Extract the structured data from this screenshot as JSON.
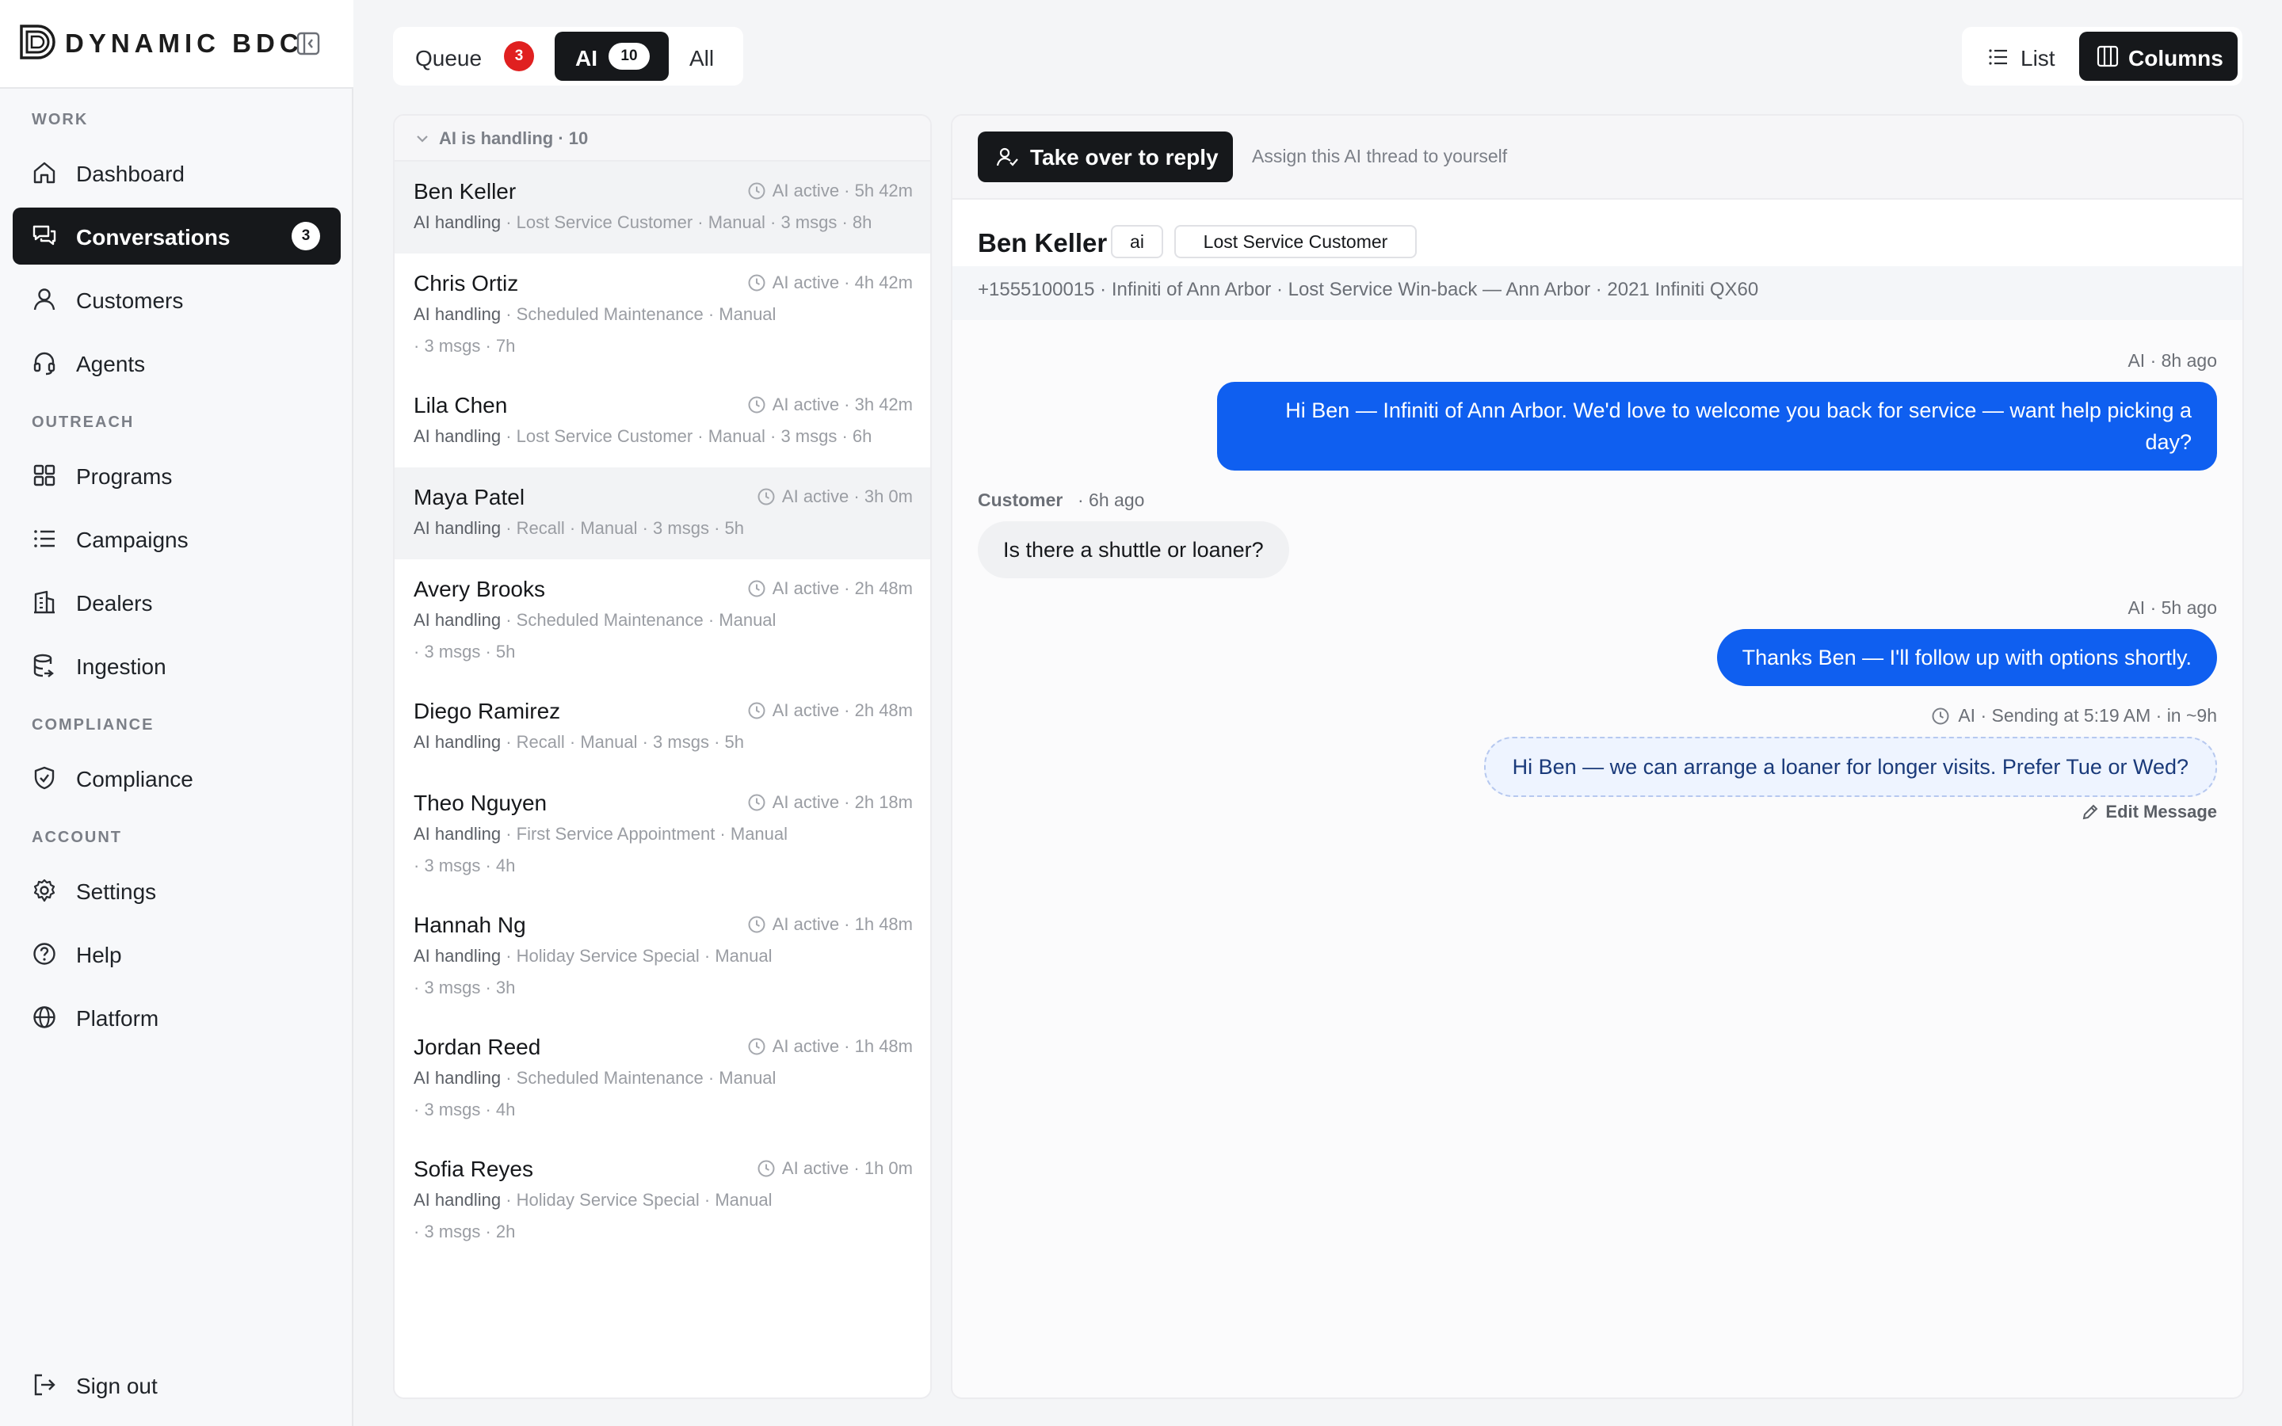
{
  "brand": {
    "name": "DYNAMIC BDC"
  },
  "sidebar": {
    "sections": {
      "work": "WORK",
      "outreach": "OUTREACH",
      "compliance": "COMPLIANCE",
      "account": "ACCOUNT"
    },
    "items": {
      "dashboard": "Dashboard",
      "conversations": "Conversations",
      "conversations_badge": "3",
      "customers": "Customers",
      "agents": "Agents",
      "programs": "Programs",
      "campaigns": "Campaigns",
      "dealers": "Dealers",
      "ingestion": "Ingestion",
      "compliance": "Compliance",
      "settings": "Settings",
      "help": "Help",
      "platform": "Platform",
      "signout": "Sign out"
    }
  },
  "filters": {
    "queue": "Queue",
    "queue_count": "3",
    "ai": "AI",
    "ai_count": "10",
    "all": "All"
  },
  "view": {
    "list": "List",
    "columns": "Columns"
  },
  "list": {
    "group_title": "AI is handling · 10",
    "ai_tag": "AI handling",
    "rows": [
      {
        "name": "Ben Keller",
        "meta": "AI active · 5h 42m",
        "sub": "· Lost Service Customer · Manual · 3 msgs · 8h",
        "sub2": ""
      },
      {
        "name": "Chris Ortiz",
        "meta": "AI active · 4h 42m",
        "sub": "· Scheduled Maintenance · Manual",
        "sub2": "· 3 msgs · 7h"
      },
      {
        "name": "Lila Chen",
        "meta": "AI active · 3h 42m",
        "sub": "· Lost Service Customer · Manual · 3 msgs · 6h",
        "sub2": ""
      },
      {
        "name": "Maya Patel",
        "meta": "AI active · 3h 0m",
        "sub": "· Recall · Manual · 3 msgs · 5h",
        "sub2": ""
      },
      {
        "name": "Avery Brooks",
        "meta": "AI active · 2h 48m",
        "sub": "· Scheduled Maintenance · Manual",
        "sub2": "· 3 msgs · 5h"
      },
      {
        "name": "Diego Ramirez",
        "meta": "AI active · 2h 48m",
        "sub": "· Recall · Manual · 3 msgs · 5h",
        "sub2": ""
      },
      {
        "name": "Theo Nguyen",
        "meta": "AI active · 2h 18m",
        "sub": "· First Service Appointment · Manual",
        "sub2": "· 3 msgs · 4h"
      },
      {
        "name": "Hannah Ng",
        "meta": "AI active · 1h 48m",
        "sub": "· Holiday Service Special · Manual",
        "sub2": "· 3 msgs · 3h"
      },
      {
        "name": "Jordan Reed",
        "meta": "AI active · 1h 48m",
        "sub": "· Scheduled Maintenance · Manual",
        "sub2": "· 3 msgs · 4h"
      },
      {
        "name": "Sofia Reyes",
        "meta": "AI active · 1h 0m",
        "sub": "· Holiday Service Special · Manual",
        "sub2": "· 3 msgs · 2h"
      }
    ]
  },
  "thread": {
    "takeover_label": "Take over to reply",
    "takeover_hint": "Assign this AI thread to yourself",
    "customer_name": "Ben Keller",
    "chip_ai": "ai",
    "chip_program": "Lost Service Customer",
    "details": "+1555100015 · Infiniti of Ann Arbor · Lost Service Win-back — Ann Arbor · 2021 Infiniti QX60",
    "messages": {
      "m1_meta": "AI · 8h ago",
      "m1_text": "Hi Ben — Infiniti of Ann Arbor. We'd love to welcome you back for service — want help picking a day?",
      "m2_meta_sender": "Customer",
      "m2_meta_time": "· 6h ago",
      "m2_text": "Is there a shuttle or loaner?",
      "m3_meta": "AI · 5h ago",
      "m3_text": "Thanks Ben — I'll follow up with options shortly.",
      "m4_meta": "AI · Sending at 5:19 AM · in ~9h",
      "m4_text": "Hi Ben — we can arrange a loaner for longer visits. Prefer Tue or Wed?",
      "edit_label": "Edit Message"
    }
  },
  "colors": {
    "accent_dark": "#16181b",
    "bubble_blue": "#0f5ff0",
    "badge_red": "#e02020"
  }
}
